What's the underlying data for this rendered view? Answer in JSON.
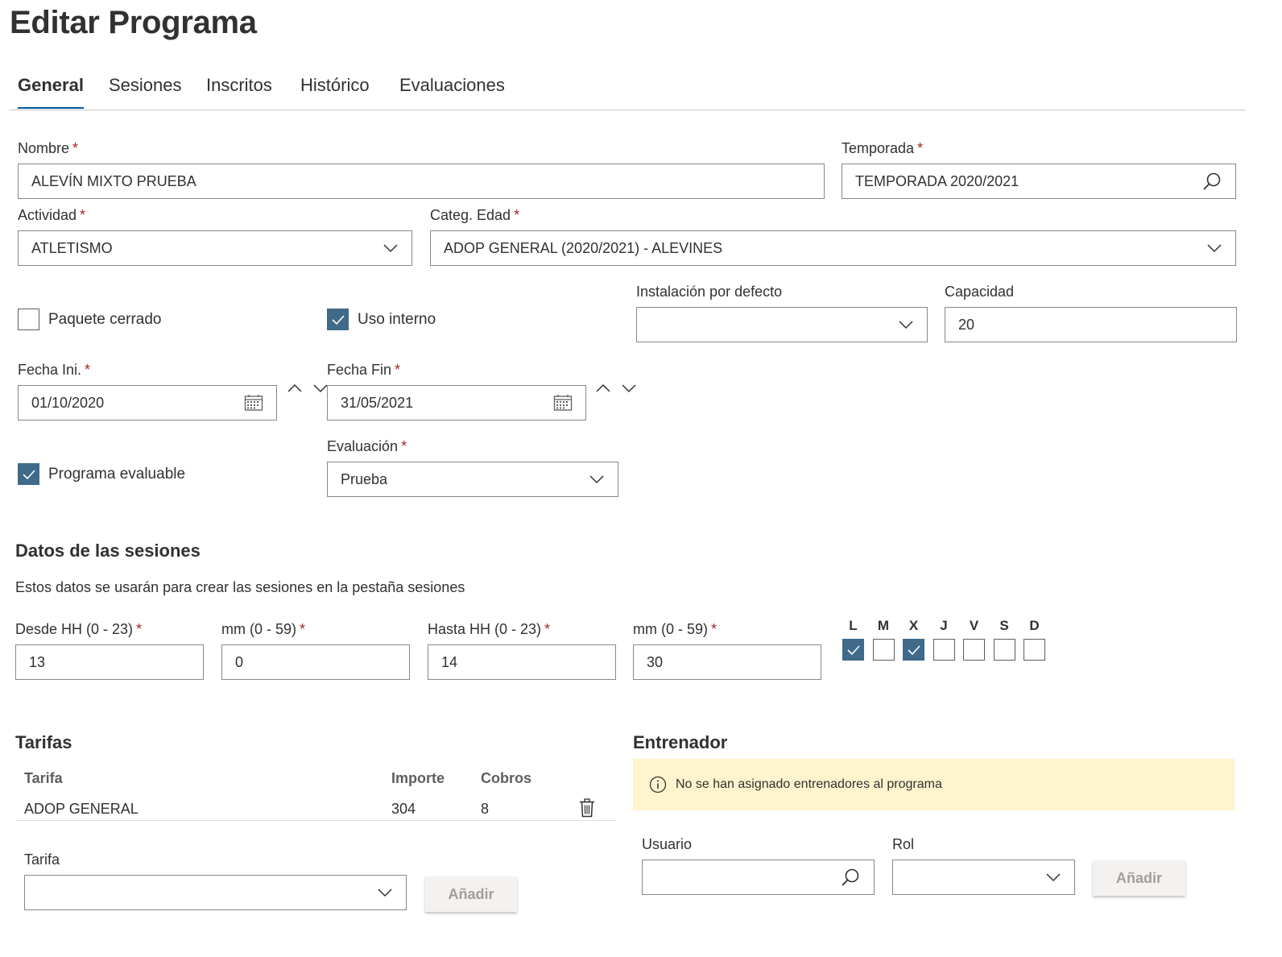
{
  "page": {
    "title": "Editar Programa"
  },
  "tabs": [
    {
      "label": "General"
    },
    {
      "label": "Sesiones"
    },
    {
      "label": "Inscritos"
    },
    {
      "label": "Histórico"
    },
    {
      "label": "Evaluaciones"
    }
  ],
  "form": {
    "nombre": {
      "label": "Nombre",
      "value": "ALEVÍN MIXTO PRUEBA"
    },
    "temporada": {
      "label": "Temporada",
      "value": "TEMPORADA 2020/2021"
    },
    "actividad": {
      "label": "Actividad",
      "value": "ATLETISMO"
    },
    "categ_edad": {
      "label": "Categ. Edad",
      "value": "ADOP GENERAL (2020/2021) - ALEVINES"
    },
    "paquete_cerrado": {
      "label": "Paquete cerrado",
      "checked": false
    },
    "uso_interno": {
      "label": "Uso interno",
      "checked": true
    },
    "instalacion": {
      "label": "Instalación por defecto",
      "value": ""
    },
    "capacidad": {
      "label": "Capacidad",
      "value": "20"
    },
    "fecha_ini": {
      "label": "Fecha Ini.",
      "value": "01/10/2020"
    },
    "fecha_fin": {
      "label": "Fecha Fin",
      "value": "31/05/2021"
    },
    "programa_evaluable": {
      "label": "Programa evaluable",
      "checked": true
    },
    "evaluacion": {
      "label": "Evaluación",
      "value": "Prueba"
    }
  },
  "sesiones": {
    "title": "Datos de las sesiones",
    "description": "Estos datos se usarán para crear las sesiones en la pestaña sesiones",
    "desde_hh": {
      "label": "Desde HH (0 - 23)",
      "value": "13"
    },
    "desde_mm": {
      "label": "mm (0 - 59)",
      "value": "0"
    },
    "hasta_hh": {
      "label": "Hasta HH (0 - 23)",
      "value": "14"
    },
    "hasta_mm": {
      "label": "mm (0 - 59)",
      "value": "30"
    },
    "days": [
      {
        "label": "L",
        "checked": true
      },
      {
        "label": "M",
        "checked": false
      },
      {
        "label": "X",
        "checked": true
      },
      {
        "label": "J",
        "checked": false
      },
      {
        "label": "V",
        "checked": false
      },
      {
        "label": "S",
        "checked": false
      },
      {
        "label": "D",
        "checked": false
      }
    ]
  },
  "tarifas": {
    "title": "Tarifas",
    "headers": {
      "tarifa": "Tarifa",
      "importe": "Importe",
      "cobros": "Cobros"
    },
    "rows": [
      {
        "tarifa": "ADOP GENERAL",
        "importe": "304",
        "cobros": "8"
      }
    ],
    "select_label": "Tarifa",
    "select_value": "",
    "add_label": "Añadir"
  },
  "entrenador": {
    "title": "Entrenador",
    "notice": "No se han asignado entrenadores al programa",
    "usuario_label": "Usuario",
    "usuario_value": "",
    "rol_label": "Rol",
    "rol_value": "",
    "add_label": "Añadir"
  },
  "colors": {
    "accent": "#005a9e",
    "checkbox": "#3f6a8a",
    "required": "#a4262c",
    "notice_bg": "#fff4ce",
    "border": "#8a8886"
  },
  "icons": [
    "search-icon",
    "chevron-down-icon",
    "calendar-icon",
    "chevron-up-icon",
    "checkmark-icon",
    "info-icon",
    "trash-icon"
  ]
}
